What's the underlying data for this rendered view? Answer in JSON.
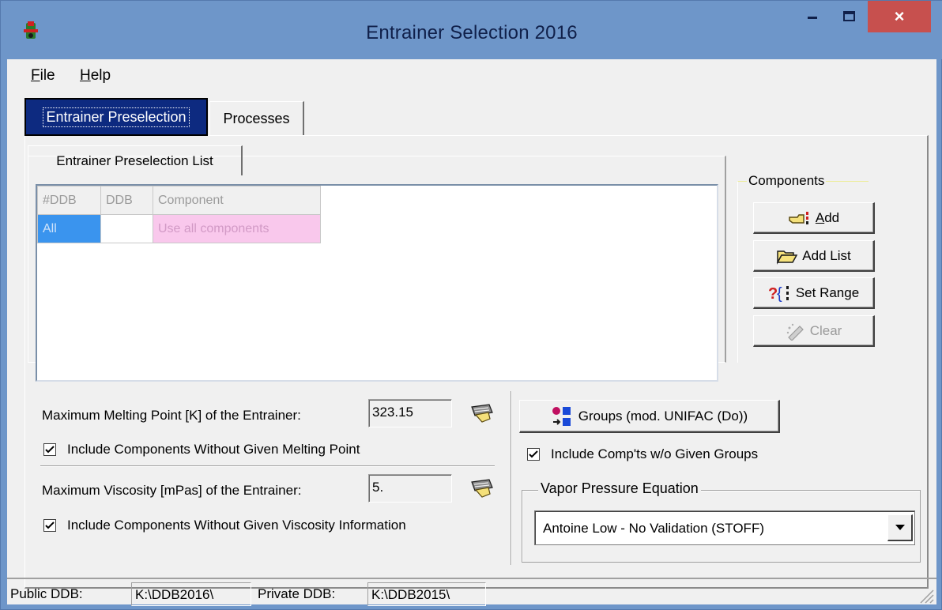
{
  "window": {
    "title": "Entrainer Selection 2016",
    "close_glyph": "×"
  },
  "menu": {
    "file": {
      "mnemonic": "F",
      "rest": "ile"
    },
    "help": {
      "mnemonic": "H",
      "rest": "elp"
    }
  },
  "tabs": {
    "entrainer_preselection": "Entrainer Preselection",
    "processes": "Processes"
  },
  "inner_tab": "Entrainer Preselection List",
  "grid": {
    "headers": [
      "#DDB",
      "DDB",
      "Component"
    ],
    "rows": [
      {
        "ddb_no": "All",
        "ddb": "",
        "component": "Use all components"
      }
    ]
  },
  "components": {
    "title": "Components",
    "add": {
      "mnemonic": "A",
      "rest": "dd"
    },
    "add_list": "Add List",
    "set_range": "Set Range",
    "clear": "Clear"
  },
  "melting": {
    "label": "Maximum Melting Point [K] of the Entrainer:",
    "value": "323.15",
    "include_label": "Include Components Without Given Melting Point",
    "include_checked": true
  },
  "viscosity": {
    "label": "Maximum Viscosity [mPas] of the Entrainer:",
    "value": "5.",
    "include_label": "Include Components Without Given Viscosity Information",
    "include_checked": true
  },
  "groups": {
    "button_label": "Groups (mod. UNIFAC (Do))",
    "include_label": "Include Comp'ts w/o Given Groups",
    "include_checked": true
  },
  "vapor_pressure": {
    "title": "Vapor Pressure Equation",
    "selected": "Antoine Low - No Validation (STOFF)"
  },
  "status": {
    "public_label": "Public DDB:",
    "public_value": "K:\\DDB2016\\",
    "private_label": "Private DDB:",
    "private_value": "K:\\DDB2015\\"
  },
  "colors": {
    "titlebar": "#6e96c9",
    "close_button": "#c7504e",
    "active_tab": "#0d2a80",
    "selected_cell": "#3a94ee",
    "pink_cell": "#f9c8ec"
  }
}
